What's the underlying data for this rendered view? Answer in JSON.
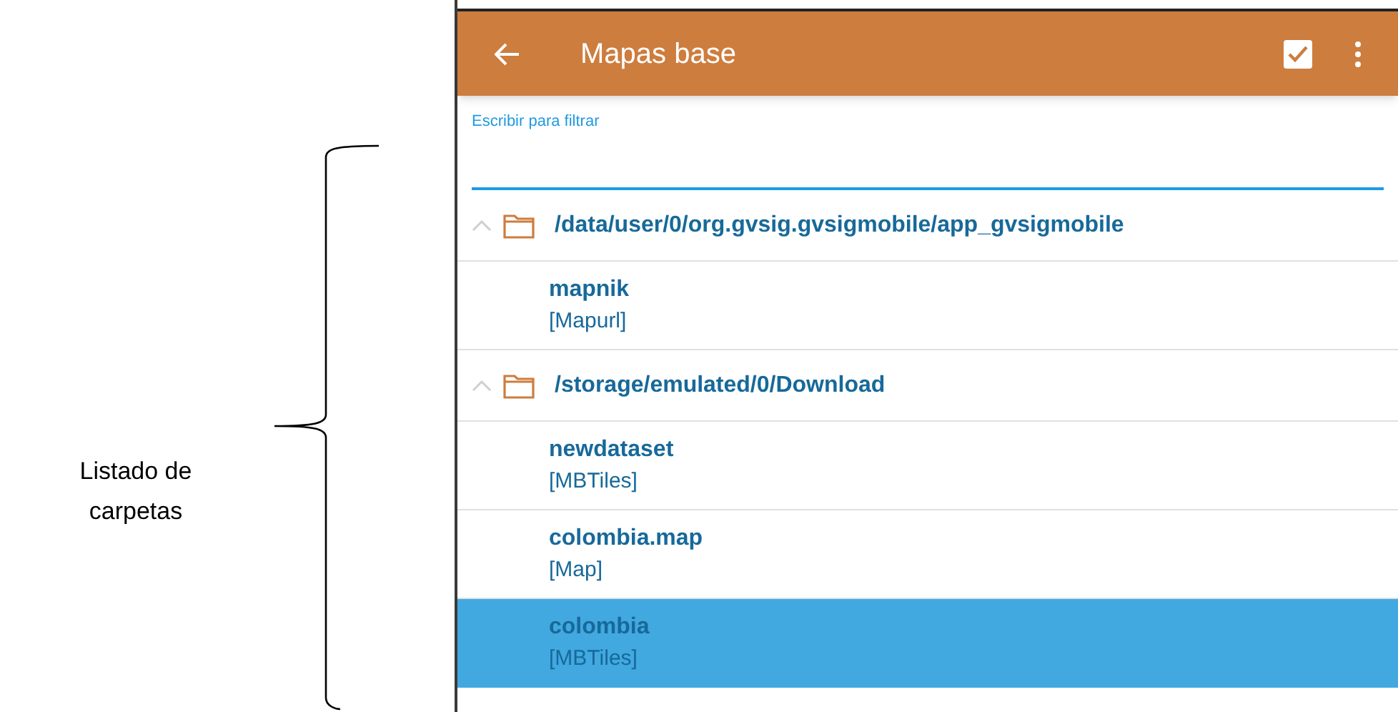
{
  "annotation": {
    "label": "Listado de carpetas"
  },
  "app_bar": {
    "title": "Mapas base"
  },
  "filter": {
    "label": "Escribir para filtrar"
  },
  "groups": [
    {
      "path": "/data/user/0/org.gvsig.gvsigmobile/app_gvsigmobile",
      "expanded": true,
      "items": [
        {
          "name": "mapnik",
          "type": "[Mapurl]",
          "selected": false
        }
      ]
    },
    {
      "path": "/storage/emulated/0/Download",
      "expanded": true,
      "items": [
        {
          "name": "newdataset",
          "type": "[MBTiles]",
          "selected": false
        },
        {
          "name": "colombia.map",
          "type": "[Map]",
          "selected": false
        },
        {
          "name": "colombia",
          "type": "[MBTiles]",
          "selected": true
        }
      ]
    }
  ]
}
